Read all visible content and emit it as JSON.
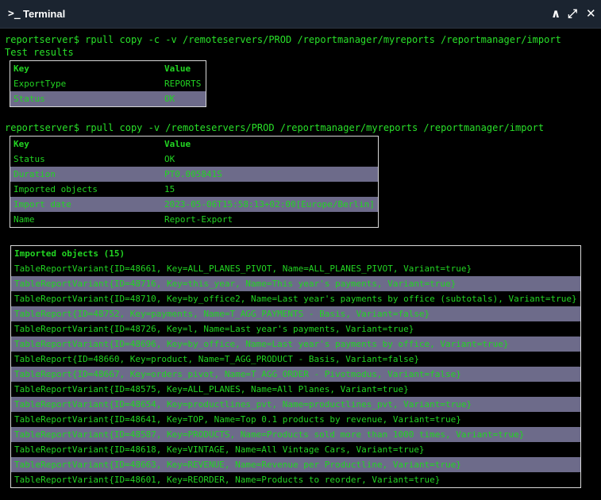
{
  "window": {
    "prompt_icon": ">_",
    "title": "Terminal",
    "controls": {
      "collapse": "❮",
      "expand": "⤢",
      "close": "✕"
    }
  },
  "session": {
    "command1": "reportserver$ rpull copy -c -v /remoteservers/PROD /reportmanager/myreports /reportmanager/import",
    "test_results_label": "Test results",
    "table1": {
      "headers": [
        "Key",
        "Value"
      ],
      "rows": [
        [
          "ExportType",
          "REPORTS"
        ],
        [
          "Status",
          "OK"
        ]
      ]
    },
    "command2": "reportserver$ rpull copy -v /remoteservers/PROD /reportmanager/myreports /reportmanager/import",
    "table2": {
      "headers": [
        "Key",
        "Value"
      ],
      "rows": [
        [
          "Status",
          "OK"
        ],
        [
          "Duration",
          "PT0.005841S"
        ],
        [
          "Imported objects",
          "15"
        ],
        [
          "Import date",
          "2023-05-06T15:58:13+02:00[Europe/Berlin]"
        ],
        [
          "Name",
          "Report-Export"
        ]
      ]
    },
    "imported": {
      "header": "Imported objects (15)",
      "items": [
        "TableReportVariant{ID=48661, Key=ALL_PLANES_PIVOT, Name=ALL_PLANES_PIVOT, Variant=true}",
        "TableReportVariant{ID=48716, Key=this_year, Name=This year's payments, Variant=true}",
        "TableReportVariant{ID=48710, Key=by_office2, Name=Last year's payments by office (subtotals), Variant=true}",
        "TableReport{ID=48752, Key=payments, Name=T_AGG_PAYMENTS - Basis, Variant=false}",
        "TableReportVariant{ID=48726, Key=l, Name=Last year's payments, Variant=true}",
        "TableReportVariant{ID=48696, Key=by_office, Name=Last year's payments by office, Variant=true}",
        "TableReport{ID=48660, Key=product, Name=T_AGG_PRODUCT - Basis, Variant=false}",
        "TableReport{ID=48667, Key=orders_pivot, Name=T_AGG_ORDER - Pivotmodus, Variant=false}",
        "TableReportVariant{ID=48575, Key=ALL_PLANES, Name=All Planes, Variant=true}",
        "TableReportVariant{ID=48654, Key=productlines_pvt, Name=productlines_pvt, Variant=true}",
        "TableReportVariant{ID=48641, Key=TOP, Name=Top 0.1 products by revenue, Variant=true}",
        "TableReportVariant{ID=48587, Key=PRODUCTS, Name=Products sold more than 1000 times, Variant=true}",
        "TableReportVariant{ID=48618, Key=VINTAGE, Name=All Vintage Cars, Variant=true}",
        "TableReportVariant{ID=48663, Key=REVENUE, Name=Revenue per Productline, Variant=true}",
        "TableReportVariant{ID=48601, Key=REORDER, Name=Products to reorder, Variant=true}"
      ]
    }
  }
}
